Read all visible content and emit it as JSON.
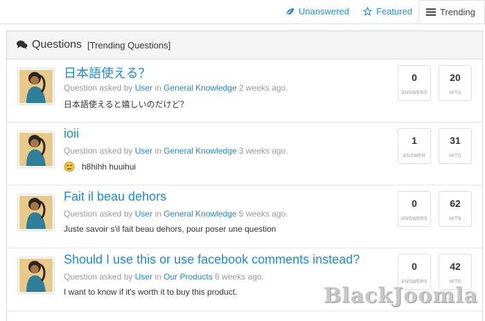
{
  "tabs": [
    {
      "label": "Unanswered",
      "icon": "leaf-icon"
    },
    {
      "label": "Featured",
      "icon": "star-icon"
    },
    {
      "label": "Trending",
      "icon": "list-icon"
    }
  ],
  "panel": {
    "title": "Questions",
    "subtitle": "[Trending Questions]",
    "icon": "comments-icon"
  },
  "questions": [
    {
      "title": "日本語使える？",
      "meta_prefix": "Question asked by",
      "user": "User",
      "in_word": "in",
      "category": "General Knowledge",
      "time": "2 weeks ago.",
      "body": "日本語使えると嬉しいのだけど？",
      "answers": "0",
      "answers_label": "ANSWERS",
      "hits": "20",
      "hits_label": "HITS"
    },
    {
      "title": "ioii",
      "meta_prefix": "Question asked by",
      "user": "User",
      "in_word": "in",
      "category": "General Knowledge",
      "time": "3 weeks ago.",
      "body": "h8hihh huuihui",
      "answers": "1",
      "answers_label": "ANSWER",
      "hits": "31",
      "hits_label": "HITS"
    },
    {
      "title": "Fait il beau dehors",
      "meta_prefix": "Question asked by",
      "user": "User",
      "in_word": "in",
      "category": "General Knowledge",
      "time": "5 weeks ago.",
      "body": "Juste savoir s'il fait beau dehors, pour poser une question",
      "answers": "0",
      "answers_label": "ANSWERS",
      "hits": "62",
      "hits_label": "HITS"
    },
    {
      "title": "Should I use this or use facebook comments instead?",
      "meta_prefix": "Question asked by",
      "user": "User",
      "in_word": "in",
      "category": "Our Products",
      "time": "6 weeks ago.",
      "body": "I want to know if it's worth it to buy this product.",
      "answers": "0",
      "answers_label": "ANSWERS",
      "hits": "42",
      "hits_label": "HITS"
    }
  ],
  "watermark": "BlackJoomla"
}
